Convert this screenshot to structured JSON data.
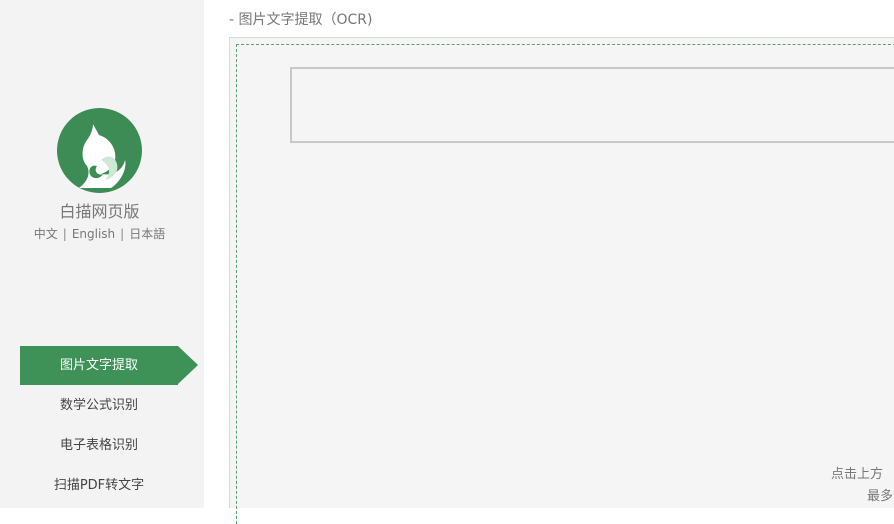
{
  "app": {
    "name": "白描网页版"
  },
  "languages": [
    "中文",
    "English",
    "日本語"
  ],
  "nav": [
    {
      "label": "图片文字提取",
      "active": true
    },
    {
      "label": "数学公式识别",
      "active": false
    },
    {
      "label": "电子表格识别",
      "active": false
    },
    {
      "label": "扫描PDF转文字",
      "active": false
    }
  ],
  "breadcrumb": "- 图片文字提取（OCR)",
  "hints": {
    "line1": "点击上方",
    "line2": "最多"
  },
  "colors": {
    "brand_green": "#3e9257",
    "sidebar_bg": "#f3f3f3",
    "work_bg": "#f5f5f5"
  },
  "icons": {
    "logo": "cat-logo-icon"
  }
}
